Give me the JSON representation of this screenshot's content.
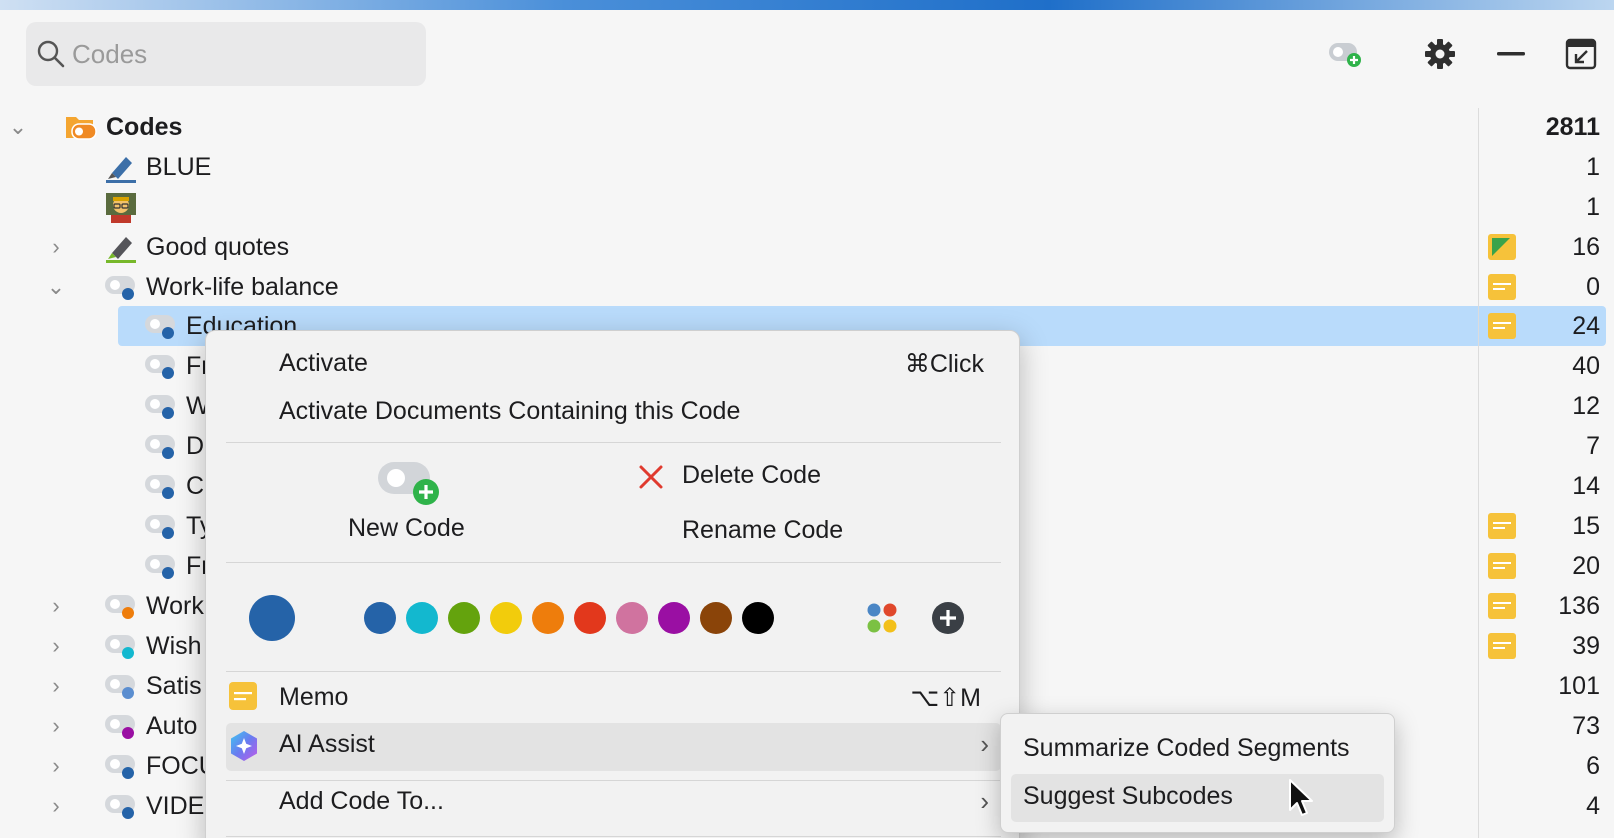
{
  "search": {
    "placeholder": "Codes",
    "icon": "search-icon"
  },
  "toolbar": {
    "icons": [
      "new-code-icon",
      "gear-icon",
      "minus-icon",
      "collapse-window-icon"
    ]
  },
  "tree": {
    "root": {
      "label": "Codes",
      "count": "2811"
    },
    "rows": [
      {
        "label": "BLUE",
        "count": "1",
        "icon": "highlighter-blue-icon"
      },
      {
        "label": "",
        "count": "1",
        "icon": "teacher-emoji-icon"
      },
      {
        "label": "Good quotes",
        "count": "16",
        "icon": "highlighter-green-icon",
        "memo": "green"
      },
      {
        "label": "Work-life balance",
        "count": "0",
        "memo": "yellow"
      },
      {
        "label": "Education",
        "count": "24",
        "memo": "yellow"
      },
      {
        "label": "Fr",
        "count": "40"
      },
      {
        "label": "W",
        "count": "12"
      },
      {
        "label": "D",
        "count": "7"
      },
      {
        "label": "C",
        "count": "14"
      },
      {
        "label": "Ty",
        "count": "15",
        "memo": "yellow"
      },
      {
        "label": "Fr",
        "count": "20",
        "memo": "yellow"
      },
      {
        "label": "Work",
        "count": "136",
        "memo": "yellow"
      },
      {
        "label": "Wish",
        "count": "39",
        "memo": "yellow"
      },
      {
        "label": "Satis",
        "count": "101"
      },
      {
        "label": "Auto",
        "count": "73"
      },
      {
        "label": "FOCU",
        "count": "6"
      },
      {
        "label": "VIDE",
        "count": "4"
      }
    ]
  },
  "context_menu": {
    "activate": "Activate",
    "activate_shortcut": "⌘Click",
    "activate_docs": "Activate Documents Containing this Code",
    "new_code": "New Code",
    "delete_code": "Delete Code",
    "rename_code": "Rename Code",
    "current_color": "#2563a8",
    "colors": [
      "#2563a8",
      "#13b8cf",
      "#64a30d",
      "#f2cc0c",
      "#ee7d0c",
      "#e2381c",
      "#d0739f",
      "#9a0fa3",
      "#8a4409",
      "#000000"
    ],
    "memo": "Memo",
    "memo_shortcut": "⌥⇧M",
    "ai_assist": "AI Assist",
    "add_code_to": "Add Code To..."
  },
  "submenu": {
    "items": [
      "Summarize Coded Segments",
      "Suggest Subcodes"
    ]
  }
}
